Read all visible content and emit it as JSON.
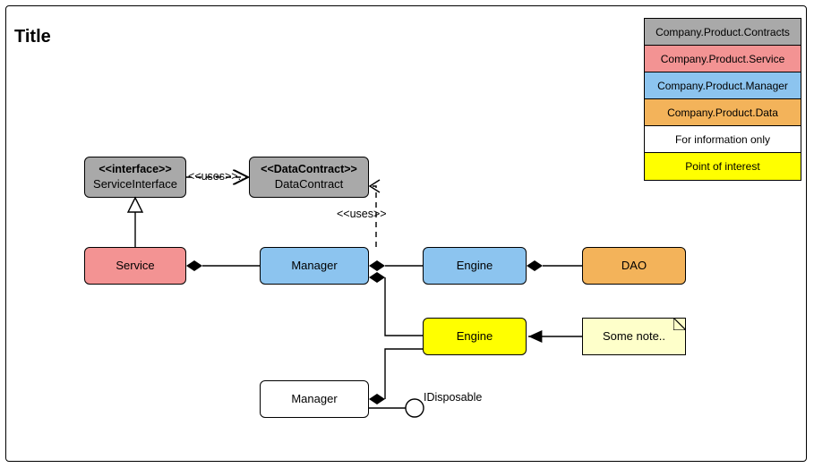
{
  "title": "Title",
  "nodes": {
    "interface": {
      "stereo": "<<interface>>",
      "name": "ServiceInterface"
    },
    "datacontract": {
      "stereo": "<<DataContract>>",
      "name": "DataContract"
    },
    "service": {
      "name": "Service"
    },
    "manager": {
      "name": "Manager"
    },
    "engine": {
      "name": "Engine"
    },
    "dao": {
      "name": "DAO"
    },
    "engine2": {
      "name": "Engine"
    },
    "note": {
      "name": "Some note.."
    },
    "manager2": {
      "name": "Manager"
    },
    "idisposable": {
      "name": "IDisposable"
    }
  },
  "labels": {
    "uses1": "<<uses>>..",
    "uses2": "<<uses>>"
  },
  "legend": [
    {
      "label": "Company.Product.Contracts",
      "color": "#a9a9a9"
    },
    {
      "label": "Company.Product.Service",
      "color": "#f39393"
    },
    {
      "label": "Company.Product.Manager",
      "color": "#8cc4ef"
    },
    {
      "label": "Company.Product.Data",
      "color": "#f3b35a"
    },
    {
      "label": "For information only",
      "color": "#ffffff"
    },
    {
      "label": "Point of interest",
      "color": "#ffff00"
    }
  ],
  "colors": {
    "contracts": "#a9a9a9",
    "service": "#f39393",
    "manager": "#8cc4ef",
    "data": "#f3b35a",
    "info": "#ffffff",
    "interest": "#ffff00",
    "note": "#feffca"
  },
  "chart_data": {
    "type": "uml-class-diagram",
    "title": "Title",
    "nodes": [
      {
        "id": "ServiceInterface",
        "stereotype": "interface",
        "package": "Company.Product.Contracts"
      },
      {
        "id": "DataContract",
        "stereotype": "DataContract",
        "package": "Company.Product.Contracts"
      },
      {
        "id": "Service",
        "package": "Company.Product.Service"
      },
      {
        "id": "Manager",
        "package": "Company.Product.Manager"
      },
      {
        "id": "Engine",
        "package": "Company.Product.Manager"
      },
      {
        "id": "DAO",
        "package": "Company.Product.Data"
      },
      {
        "id": "Engine2",
        "label": "Engine",
        "highlight": "Point of interest"
      },
      {
        "id": "Manager2",
        "label": "Manager",
        "info": true
      },
      {
        "id": "IDisposable",
        "kind": "lollipop-interface"
      },
      {
        "id": "NoteA",
        "kind": "note",
        "text": "Some note.."
      }
    ],
    "edges": [
      {
        "from": "ServiceInterface",
        "to": "DataContract",
        "type": "dependency",
        "label": "<<uses>>"
      },
      {
        "from": "Service",
        "to": "ServiceInterface",
        "type": "realization"
      },
      {
        "from": "Manager",
        "to": "DataContract",
        "type": "dependency",
        "label": "<<uses>>"
      },
      {
        "from": "Service",
        "to": "Manager",
        "type": "composition"
      },
      {
        "from": "Manager",
        "to": "Engine",
        "type": "composition"
      },
      {
        "from": "Engine",
        "to": "DAO",
        "type": "composition"
      },
      {
        "from": "Manager",
        "to": "Engine2",
        "type": "composition"
      },
      {
        "from": "Engine2",
        "to": "Manager2",
        "type": "composition"
      },
      {
        "from": "NoteA",
        "to": "Engine2",
        "type": "note-anchor"
      },
      {
        "from": "Manager2",
        "to": "IDisposable",
        "type": "provided-interface"
      }
    ],
    "legend": [
      "Company.Product.Contracts",
      "Company.Product.Service",
      "Company.Product.Manager",
      "Company.Product.Data",
      "For information only",
      "Point of interest"
    ]
  }
}
